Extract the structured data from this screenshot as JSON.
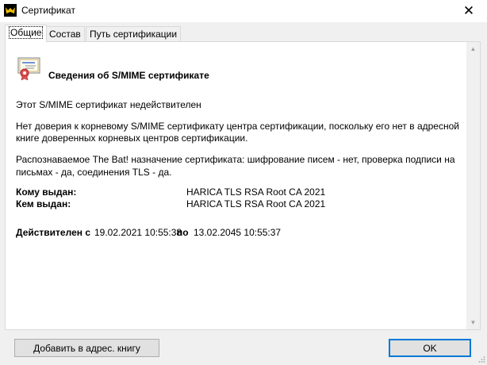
{
  "window": {
    "title": "Сертификат",
    "close_symbol": "✕"
  },
  "tabs": [
    {
      "label": "Общие",
      "active": true
    },
    {
      "label": "Состав",
      "active": false
    },
    {
      "label": "Путь сертификации",
      "active": false
    }
  ],
  "general": {
    "heading": "Сведения об S/MIME сертификате",
    "status": "Этот S/MIME сертификат недействителен",
    "trust_line1": "Нет доверия к корневому S/MIME сертификату центра сертификации, поскольку его нет в адресной",
    "trust_line2": "книге доверенных корневых центров сертификации.",
    "purpose_line1": "Распознаваемое The Bat! назначение сертификата: шифрование писем - нет, проверка подписи на",
    "purpose_line2": "письмах - да, соединения TLS - да.",
    "issued_to_label": "Кому выдан:",
    "issued_to": "HARICA TLS RSA Root CA 2021",
    "issued_by_label": "Кем выдан:",
    "issued_by": "HARICA TLS RSA Root CA 2021",
    "valid_from_label": "Действителен с",
    "valid_from": "19.02.2021 10:55:38",
    "valid_to_label": "по",
    "valid_to": "13.02.2045 10:55:37"
  },
  "buttons": {
    "add_to_addressbook": "Добавить в адрес. книгу",
    "ok": "OK"
  },
  "icons": {
    "app": "the-bat-icon",
    "cert": "certificate-icon"
  }
}
